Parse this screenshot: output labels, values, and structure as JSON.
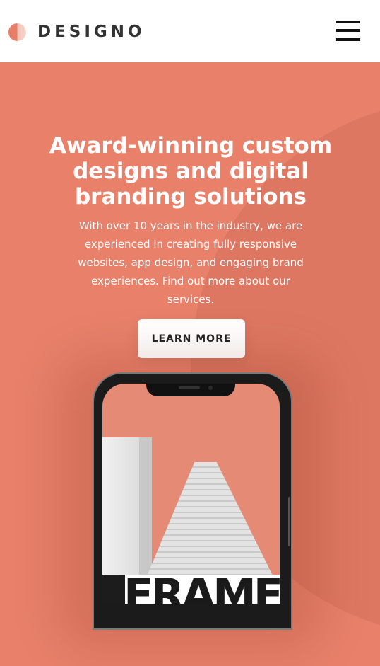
{
  "header": {
    "logo_text": "DESIGNO",
    "menu_icon": "hamburger-menu-icon"
  },
  "hero": {
    "title": "Award-winning custom designs and digital branding solutions",
    "description": "With over 10 years in the industry, we are experienced in creating fully responsive websites, app design, and engaging brand experiences. Find out more about our services.",
    "cta_label": "LEARN MORE"
  },
  "phone_image": {
    "overlay_text": "FRAME"
  },
  "colors": {
    "brand": "#e8806a",
    "brand_dark": "#dc7561",
    "text_dark": "#333333",
    "white": "#ffffff"
  }
}
